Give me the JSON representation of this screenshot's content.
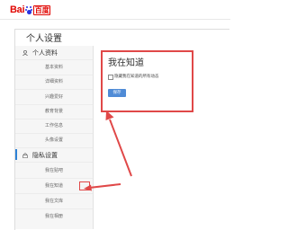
{
  "logo": {
    "bai": "Bai",
    "du": "百度"
  },
  "page": {
    "title": "个人设置"
  },
  "sidebar": {
    "section1": "个人资料",
    "items1": [
      "基本资料",
      "详细资料",
      "兴趣爱好",
      "教育背景",
      "工作信息",
      "头像设置"
    ],
    "section2": "隐私设置",
    "items2": [
      "我在贴吧",
      "我在知道",
      "我在文库",
      "我在相册"
    ]
  },
  "popup": {
    "title": "我在知道",
    "checkbox_label": "隐藏我在知道的所有动态",
    "save_label": "保存"
  },
  "colors": {
    "accent": "#4f8bd6",
    "annotation": "#e04848",
    "brand_red": "#e10602",
    "brand_blue": "#2932e1"
  }
}
